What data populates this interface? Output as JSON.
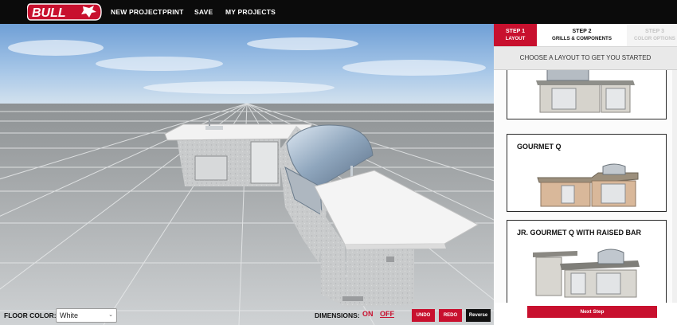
{
  "brand": {
    "logo_text": "BULL",
    "accent": "#c8102e"
  },
  "nav": {
    "new_project": "NEW PROJECT",
    "print": "PRINT",
    "save": "SAVE",
    "my_projects": "MY PROJECTS"
  },
  "steps": [
    {
      "num": "STEP 1",
      "label": "LAYOUT",
      "active": true
    },
    {
      "num": "STEP 2",
      "label": "GRILLS & COMPONENTS",
      "active": false
    },
    {
      "num": "STEP 3",
      "label": "COLOR OPTIONS",
      "active": false
    }
  ],
  "panel": {
    "heading": "CHOOSE A LAYOUT TO GET YOU STARTED",
    "cards": [
      {
        "title": ""
      },
      {
        "title": "GOURMET Q"
      },
      {
        "title": "JR. GOURMET Q WITH RAISED BAR"
      }
    ],
    "next_label": "Next Step"
  },
  "controls": {
    "floor_label": "FLOOR COLOR:",
    "floor_value": "White",
    "dimensions_label": "DIMENSIONS:",
    "on_label": "ON",
    "off_label": "OFF",
    "undo_label": "UNDO",
    "redo_label": "REDO",
    "reverse_label": "Reverse"
  }
}
